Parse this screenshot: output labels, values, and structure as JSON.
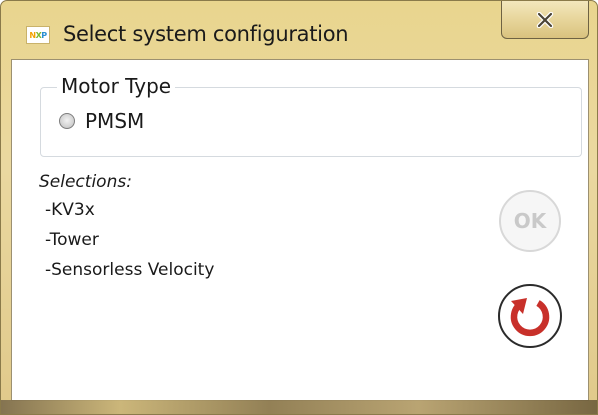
{
  "window": {
    "title": "Select system configuration",
    "icon": "nxp-logo-icon",
    "close_icon": "close-x-icon"
  },
  "motor_type": {
    "legend": "Motor Type",
    "options": [
      {
        "label": "PMSM",
        "selected": false
      }
    ]
  },
  "selections": {
    "title": "Selections:",
    "items": [
      "-KV3x",
      "-Tower",
      "-Sensorless Velocity"
    ]
  },
  "buttons": {
    "ok_label": "OK",
    "ok_enabled": false,
    "reset_icon": "reset-arrow-icon"
  },
  "colors": {
    "frame": "#e9d58e",
    "reset_accent": "#c8302a",
    "ok_disabled": "#c9c9c9"
  }
}
